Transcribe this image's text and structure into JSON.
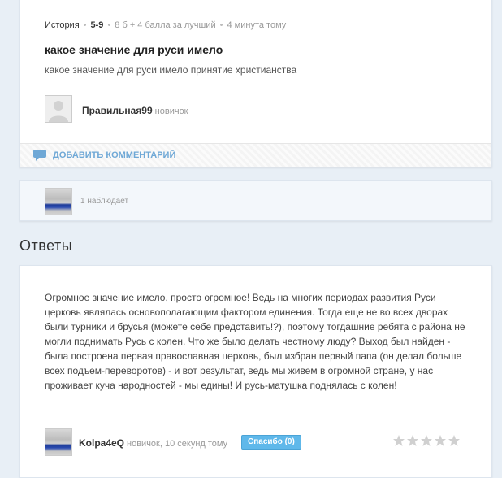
{
  "question": {
    "subject": "История",
    "grade": "5-9",
    "points": "8 б + 4 балла за лучший",
    "time": "4 минута тому",
    "title": "какое значение для руси имело",
    "body": "какое значение для руси имело принятие христианства",
    "author": {
      "name": "Правильная99",
      "rank": "новичок"
    },
    "add_comment_label": "ДОБАВИТЬ КОММЕНТАРИЙ"
  },
  "watchers": {
    "text": "1 наблюдает"
  },
  "answers_section": {
    "title": "Ответы"
  },
  "answer": {
    "text": "Огромное значение имело, просто огромное! Ведь на многих периодах развития Руси церковь являлась основополагающим фактором единения. Тогда еще не во всех дворах были турники и брусья (можете себе представить!?), поэтому тогдашние ребята с района не могли поднимать Русь с колен. Что же было делать честному люду? Выход был найден - была построена первая православная церковь, был избран первый папа (он делал больше всех подъем-переворотов) - и вот результат, ведь мы живем в огромной стране, у нас проживает куча народностей - мы едины! И русь-матушка поднялась с колен!",
    "author": {
      "name": "Kolpa4eQ",
      "meta": "новичок, 10 секунд тому"
    },
    "thanks_label": "Спасибо (0)",
    "rating": 0,
    "rating_max": 5
  },
  "colors": {
    "accent": "#5fb8ea",
    "link": "#6fa8d6",
    "star_empty": "#d0d0d0"
  },
  "icons": {
    "comment": "speech-bubble-icon",
    "star": "star-icon"
  }
}
